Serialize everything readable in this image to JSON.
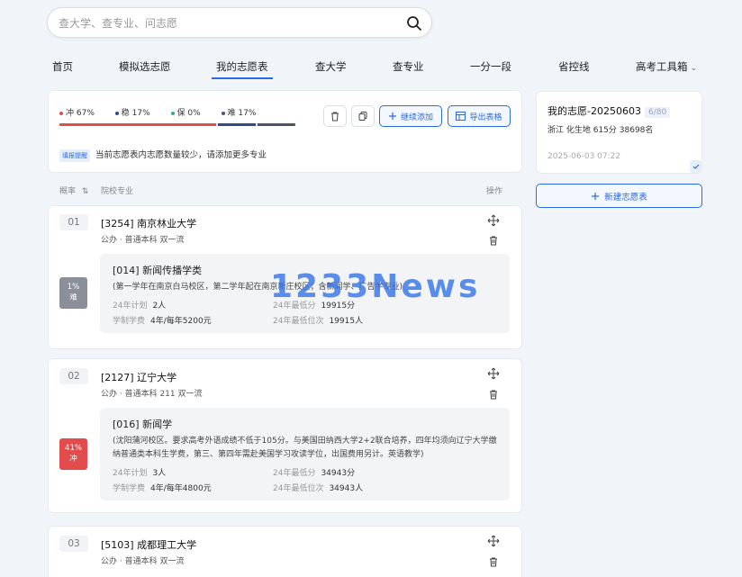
{
  "search": {
    "placeholder": "查大学、查专业、问志愿"
  },
  "nav": {
    "items": [
      "首页",
      "模拟选志愿",
      "我的志愿表",
      "查大学",
      "查专业",
      "一分一段",
      "省控线",
      "高考工具箱"
    ],
    "active": "我的志愿表"
  },
  "stats": {
    "chong": "冲 67%",
    "wen": "稳 17%",
    "bao": "保 0%",
    "nan": "难 17%",
    "fractions": {
      "chong": 0.67,
      "wen": 0.17,
      "bao": 0.0,
      "nan": 0.17
    },
    "colors": {
      "chong": "#e24c4c",
      "wen": "#2f4b8a",
      "bao": "#2eae8b",
      "nan": "#4a5668"
    }
  },
  "toolbar": {
    "continue_label": "继续添加",
    "export_label": "导出表格",
    "icons": [
      "trash-icon",
      "copy-icon",
      "plus-icon",
      "table-icon"
    ]
  },
  "notice": {
    "tag": "填报提醒",
    "text": "当前志愿表内志愿数量较少，请添加更多专业"
  },
  "table_header": {
    "rate": "概率",
    "school": "院校专业",
    "action": "操作"
  },
  "entries": [
    {
      "num": "01",
      "name": "[3254] 南京林业大学",
      "meta": "公办 · 普通本科 双一流",
      "prob_value": "1%",
      "prob_label": "难",
      "prob_color": "#8a8f99",
      "major_name": "[014] 新闻传播学类",
      "major_desc": "(第一学年在南京白马校区，第二学年起在南京新庄校区；含新闻学、广告学专业)",
      "plan_label": "24年计划",
      "plan_value": "2人",
      "min_score_label": "24年最低分",
      "min_score_value": "19915分",
      "fee_label": "学制学费",
      "fee_value": "4年/每年5200元",
      "min_rank_label": "24年最低位次",
      "min_rank_value": "19915人"
    },
    {
      "num": "02",
      "name": "[2127] 辽宁大学",
      "meta": "公办 · 普通本科 211 双一流",
      "prob_value": "41%",
      "prob_label": "冲",
      "prob_color": "#e24c4c",
      "major_name": "[016] 新闻学",
      "major_desc": "(沈阳蒲河校区。要求高考外语成绩不低于105分。与美国田纳西大学2+2联合培养，四年均须向辽宁大学缴纳普通类本科生学费，第三、第四年需赴美国学习攻读学位，出国费用另计。英语教学)",
      "plan_label": "24年计划",
      "plan_value": "3人",
      "min_score_label": "24年最低分",
      "min_score_value": "34943分",
      "fee_label": "学制学费",
      "fee_value": "4年/每年4800元",
      "min_rank_label": "24年最低位次",
      "min_rank_value": "34943人"
    },
    {
      "num": "03",
      "name": "[5103] 成都理工大学",
      "meta": "公办 · 普通本科 双一流"
    }
  ],
  "watermark": "1233News",
  "volunteer": {
    "title": "我的志愿-20250603",
    "count": "6/80",
    "info": "浙江 化生地 615分 38698名",
    "date": "2025-06-03 07:22"
  },
  "new_button": {
    "label": "新建志愿表"
  }
}
